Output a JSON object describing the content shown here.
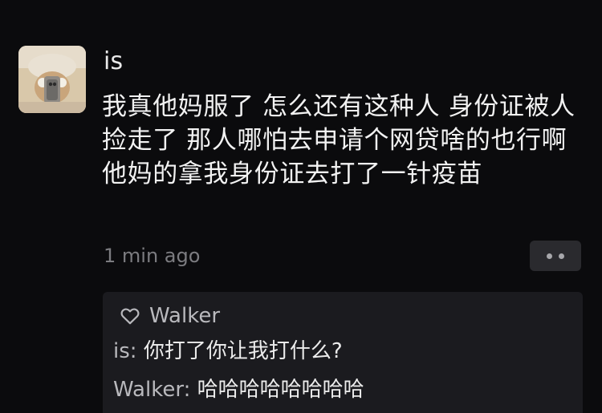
{
  "post": {
    "author": "is",
    "content": "我真他妈服了 怎么还有这种人 身份证被人捡走了 那人哪怕去申请个网贷啥的也行啊 他妈的拿我身份证去打了一针疫苗",
    "time": "1 min ago"
  },
  "likes": {
    "icon": "heart-outline-icon",
    "name": "Walker"
  },
  "comments": [
    {
      "author": "is",
      "separator": ": ",
      "text": "你打了你让我打什么?"
    },
    {
      "author": "Walker",
      "separator": ": ",
      "text": "哈哈哈哈哈哈哈哈"
    }
  ],
  "colors": {
    "background": "#0b0b0d",
    "comment_panel": "#1b1b1f",
    "muted_text": "#7c7c80"
  }
}
